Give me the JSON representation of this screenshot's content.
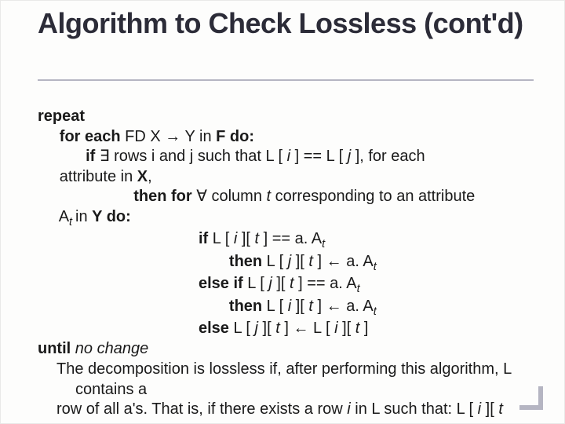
{
  "title": "Algorithm to Check Lossless (cont'd)",
  "alg": {
    "repeat": "repeat",
    "foreach_pre": "for each",
    "foreach_mid_fd": " FD X ",
    "arrow_r": "→",
    "foreach_mid_yin": " Y in ",
    "foreach_F": "F",
    "foreach_do": " do:",
    "if_kw": "if ",
    "exists": "∃",
    "if_text": " rows i and j such that L [ ",
    "i": "i",
    "eq_mid": " ] == L [ ",
    "j": "j",
    "if_tail": " ], for each",
    "attr_in": "attribute in ",
    "X": "X",
    "comma": ",",
    "then_for": "then for ",
    "forall": "∀",
    "col_txt": " column ",
    "t": "t",
    "corr": " corresponding to an attribute",
    "At_line_pre": "A",
    "At_line_t": "t ",
    "At_line_in": "in ",
    "Y": "Y",
    "do2": " do:",
    "inner": {
      "l1_pre": "if",
      "l1": " L [ ",
      "l1b": " ][ ",
      "l1c": " ] == a. ",
      "aA": "A",
      "l2_pre": "then",
      "l2": " L [ ",
      "l2b": " ][ ",
      "l2c": " ] ",
      "larrow": "←",
      "l2d": " a. ",
      "l3_pre": "else if",
      "l5_pre": "else",
      "l5a": " L [ ",
      "l5b": " ][ ",
      "l5c": " ] ",
      "l5d": " L [ ",
      "l5e": " ][ ",
      "l5f": " ]"
    },
    "until": "until",
    "nochange": " no change"
  },
  "conclusion": {
    "line1": "The decomposition is lossless if, after performing this algorithm, L contains a",
    "line2_pre": " row of all a's. That is, if there exists a row ",
    "line2_i": "i",
    "line2_mid": " in L such that: L [ ",
    "line2_i2": "i",
    "line2_tail": " ][ ",
    "line2_t": "t"
  }
}
